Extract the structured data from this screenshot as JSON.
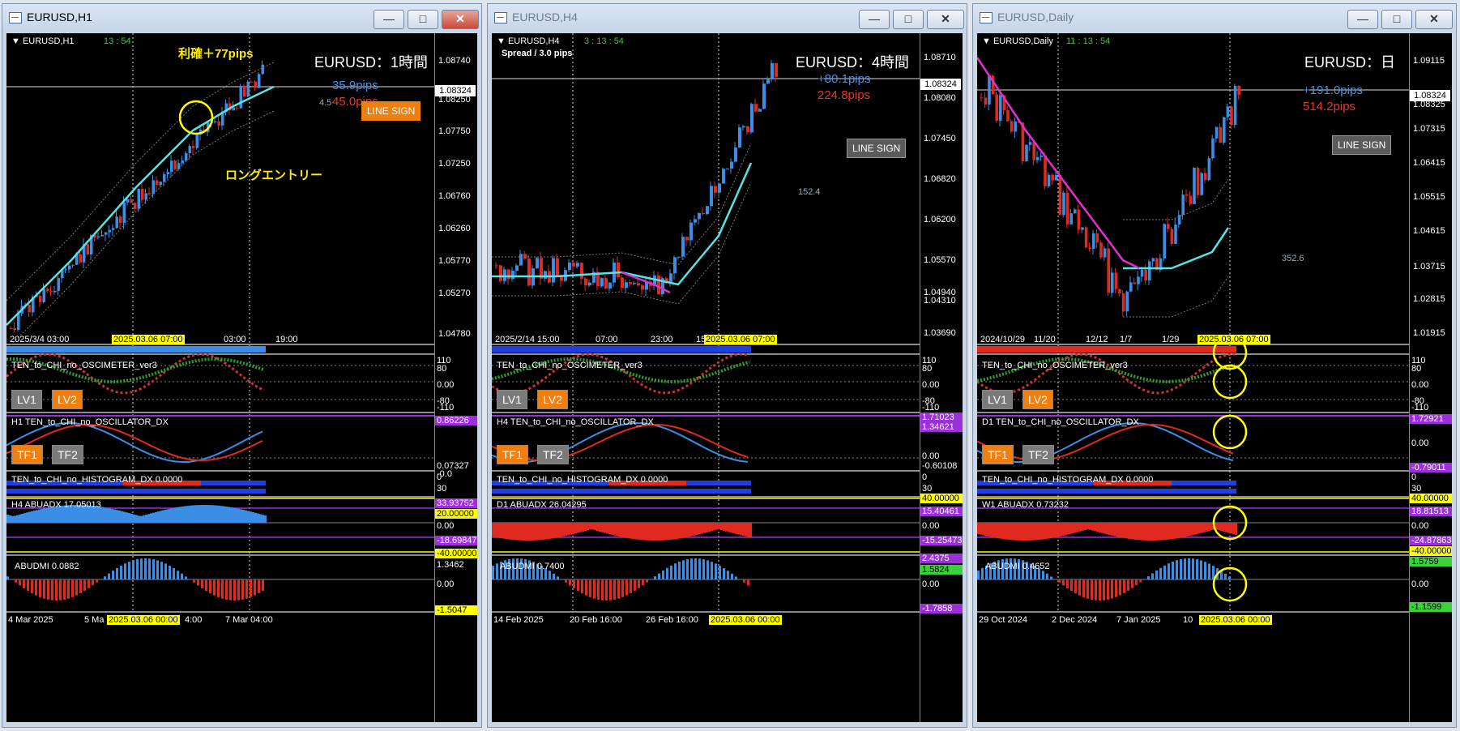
{
  "windows": [
    {
      "title": "EURUSD,H1",
      "symbol_label": "EURUSD,H1",
      "clock": "13 : 54",
      "big_title": "EURUSD：1時間",
      "pips_blue": "35.9pips",
      "pips_red": "45.0pips",
      "extra_label": "4.5",
      "line_sign": "LINE SIGN",
      "annotation_top": "利確＋77pips",
      "annotation_bottom": "ロングエントリー",
      "current_price": "1.08324",
      "price_labels": [
        "1.08740",
        "1.08250",
        "1.07750",
        "1.07250",
        "1.06760",
        "1.06260",
        "1.05770",
        "1.05270",
        "1.04780"
      ],
      "time_labels": [
        "2025/3/4  03:00",
        "2025.03.06 07:00",
        "03:00",
        "19:00"
      ],
      "osc_name": "TEN_to_CHI_no_OSCIMETER_ver3",
      "osc_levels": [
        "110",
        "80",
        "0.00",
        "-80",
        "-110"
      ],
      "lv1": "LV1",
      "lv2": "LV2",
      "dx_name": "H1 TEN_to_CHI_no_OSCILLATOR_DX",
      "dx_values": [
        "0.86226",
        "0.07327",
        "-0.0"
      ],
      "tf1": "TF1",
      "tf2": "TF2",
      "hist_name": "TEN_to_CHI_no_HISTOGRAM_DX 0.0000",
      "hist_levels": [
        "0",
        "30"
      ],
      "abuadx_name": "H4 ABUADX  17.05013",
      "abuadx_values": [
        "33.93752",
        "20.00000",
        "0.00",
        "-18.69847",
        "-40.00000"
      ],
      "abudmi_name": "ABUDMI  0.0882",
      "abudmi_values": [
        "1.3462",
        "0.00",
        "-1.5047"
      ],
      "bottom_time": [
        "4 Mar 2025",
        "5 Ma",
        "2025.03.06 00:00",
        "4:00",
        "7 Mar 04:00"
      ]
    },
    {
      "title": "EURUSD,H4",
      "symbol_label": "EURUSD,H4",
      "clock": "3 : 13 : 54",
      "spread": "Spread / 3.0 pips",
      "big_title": "EURUSD：4時間",
      "pips_blue": "+80.1pips",
      "pips_red": "224.8pips",
      "extra_label": "152.4",
      "line_sign": "LINE SIGN",
      "current_price": "1.08324",
      "price_labels": [
        "1.08710",
        "1.08080",
        "1.07450",
        "1.06820",
        "1.06200",
        "1.05570",
        "1.04940",
        "1.04310",
        "1.03690"
      ],
      "time_labels": [
        "2025/2/14 15:00",
        "07:00",
        "23:00",
        "15",
        "2025.03.06 07:00"
      ],
      "osc_name": "TEN_to_CHI_no_OSCIMETER_ver3",
      "osc_levels": [
        "110",
        "80",
        "0.00",
        "-80",
        "-110"
      ],
      "lv1": "LV1",
      "lv2": "LV2",
      "dx_name": "H4 TEN_to_CHI_no_OSCILLATOR_DX",
      "dx_values": [
        "1.71023",
        "1.34621",
        "0.00",
        "-0.60108"
      ],
      "tf1": "TF1",
      "tf2": "TF2",
      "hist_name": "TEN_to_CHI_no_HISTOGRAM_DX 0.0000",
      "hist_levels": [
        "0",
        "30"
      ],
      "abuadx_name": "D1 ABUADX  26.04295",
      "abuadx_values": [
        "40.00000",
        "15.40461",
        "0.00",
        "-15.25473"
      ],
      "abudmi_name": "ABUDMI  0.7400",
      "abudmi_values": [
        "2.4375",
        "1.5824",
        "0.00",
        "-1.7858"
      ],
      "bottom_time": [
        "14 Feb 2025",
        "20 Feb 16:00",
        "26 Feb 16:00",
        "2025.03.06 00:00"
      ]
    },
    {
      "title": "EURUSD,Daily",
      "symbol_label": "EURUSD,Daily",
      "clock": "11 : 13 : 54",
      "big_title": "EURUSD：日",
      "pips_blue": "+191.0pips",
      "pips_red": "514.2pips",
      "extra_label": "352.6",
      "line_sign": "LINE SIGN",
      "current_price": "1.08324",
      "price_labels": [
        "1.09115",
        "1.08325",
        "1.07315",
        "1.06415",
        "1.05515",
        "1.04615",
        "1.03715",
        "1.02815",
        "1.01915"
      ],
      "time_labels": [
        "2024/10/29",
        "11/20",
        "12/12",
        "1/7",
        "1/29",
        "2025.03.06 07:00"
      ],
      "osc_name": "TEN_to_CHI_no_OSCIMETER_ver3",
      "osc_levels": [
        "110",
        "80",
        "0.00",
        "-80",
        "-110"
      ],
      "lv1": "LV1",
      "lv2": "LV2",
      "dx_name": "D1 TEN_to_CHI_no_OSCILLATOR_DX",
      "dx_values": [
        "1.72921",
        "0.00",
        "-0.79011"
      ],
      "tf1": "TF1",
      "tf2": "TF2",
      "hist_name": "TEN_to_CHI_no_HISTOGRAM_DX 0.0000",
      "hist_levels": [
        "0",
        "30"
      ],
      "abuadx_name": "W1 ABUADX  0.73232",
      "abuadx_values": [
        "40.00000",
        "18.81513",
        "0.00",
        "-24.87863",
        "-40.00000"
      ],
      "abudmi_name": "ABUDMI  0.4652",
      "abudmi_values": [
        "1.5759",
        "0.00",
        "-1.1599"
      ],
      "bottom_time": [
        "29 Oct 2024",
        "2 Dec 2024",
        "7 Jan 2025",
        "10",
        "2025.03.06 00:00"
      ]
    }
  ],
  "colors": {
    "bull": "#3a8ee6",
    "bear": "#e02a1f",
    "ma_cyan": "#54e6e6",
    "ma_magenta": "#e030d0",
    "highlight": "#ffff00"
  }
}
